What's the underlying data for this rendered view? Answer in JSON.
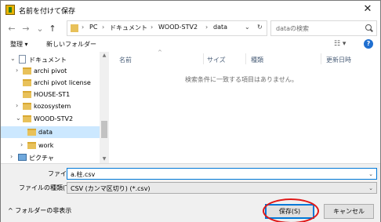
{
  "window": {
    "title": "名前を付けて保存",
    "close_glyph": "✕"
  },
  "address_bar": {
    "crumbs": [
      "PC",
      "ドキュメント",
      "WOOD-STV2",
      "data"
    ],
    "separator": "›",
    "dropdown_glyph": "⌄",
    "refresh_glyph": "↻"
  },
  "nav_buttons": {
    "back": "←",
    "forward": "→",
    "recent": "⌄",
    "up": "↑"
  },
  "search": {
    "placeholder": "dataの検索"
  },
  "toolbar": {
    "organize": "整理 ▾",
    "new_folder": "新しいフォルダー",
    "view_glyph": "☷ ▾",
    "help_glyph": "?"
  },
  "tree": {
    "items": [
      {
        "label": "ドキュメント",
        "chevron": "⌄",
        "icon": "document-icon"
      },
      {
        "label": "archi pivot",
        "chevron": "›",
        "icon": "folder-icon"
      },
      {
        "label": "archi pivot license",
        "chevron": "",
        "icon": "folder-icon"
      },
      {
        "label": "HOUSE-ST1",
        "chevron": "",
        "icon": "folder-icon"
      },
      {
        "label": "kozosystem",
        "chevron": "›",
        "icon": "folder-icon"
      },
      {
        "label": "WOOD-STV2",
        "chevron": "⌄",
        "icon": "folder-icon"
      },
      {
        "label": "data",
        "chevron": "",
        "icon": "folder-icon",
        "selected": true
      },
      {
        "label": "work",
        "chevron": "›",
        "icon": "folder-icon"
      },
      {
        "label": "ピクチャ",
        "chevron": "›",
        "icon": "pictures-icon"
      }
    ],
    "scroll_up_glyph": "▲",
    "scroll_down_glyph": "▼"
  },
  "file_list": {
    "columns": [
      "名前",
      "サイズ",
      "種類",
      "更新日時"
    ],
    "sort_glyph": "^",
    "empty_message": "検索条件に一致する項目はありません。"
  },
  "form": {
    "filename_label": "ファイル名(N):",
    "filename_value": "a.柱.csv",
    "filetype_label": "ファイルの種類(T):",
    "filetype_value": "CSV (カンマ区切り) (*.csv)",
    "dropdown_glyph": "⌄"
  },
  "footer": {
    "hide_folders": "^ フォルダーの非表示",
    "save_button": "保存(S)",
    "cancel_button": "キャンセル"
  },
  "colors": {
    "accent": "#0078d7",
    "highlight_ring": "#e01818",
    "selected_row": "#cce8ff"
  }
}
